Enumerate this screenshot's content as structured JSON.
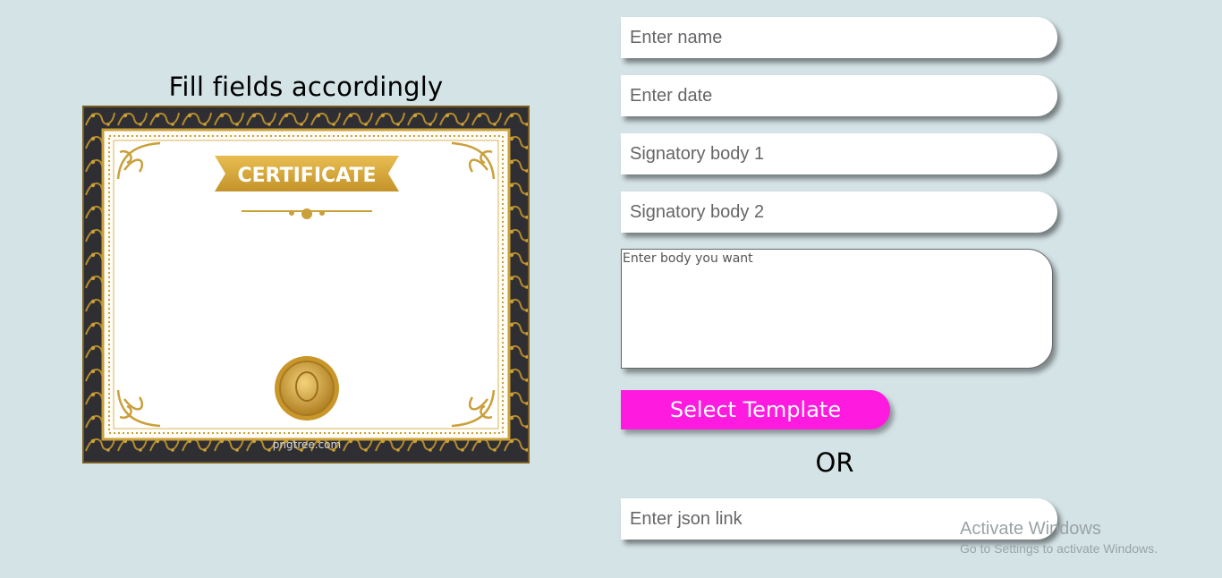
{
  "heading": "Fill fields accordingly",
  "certificate": {
    "ribbon_text": "CERTIFICATE",
    "watermark": "pngtree.com"
  },
  "form": {
    "name_placeholder": "Enter name",
    "date_placeholder": "Enter date",
    "signatory1_placeholder": "Signatory body 1",
    "signatory2_placeholder": "Signatory body 2",
    "body_placeholder": "Enter body you want",
    "select_template_label": "Select Template",
    "or_label": "OR",
    "json_link_placeholder": "Enter json link"
  },
  "windows_watermark": {
    "title": "Activate Windows",
    "subtitle": "Go to Settings to activate Windows."
  },
  "colors": {
    "background": "#d4e3e6",
    "accent": "#ff1adf",
    "gold": "#c9a03a"
  }
}
